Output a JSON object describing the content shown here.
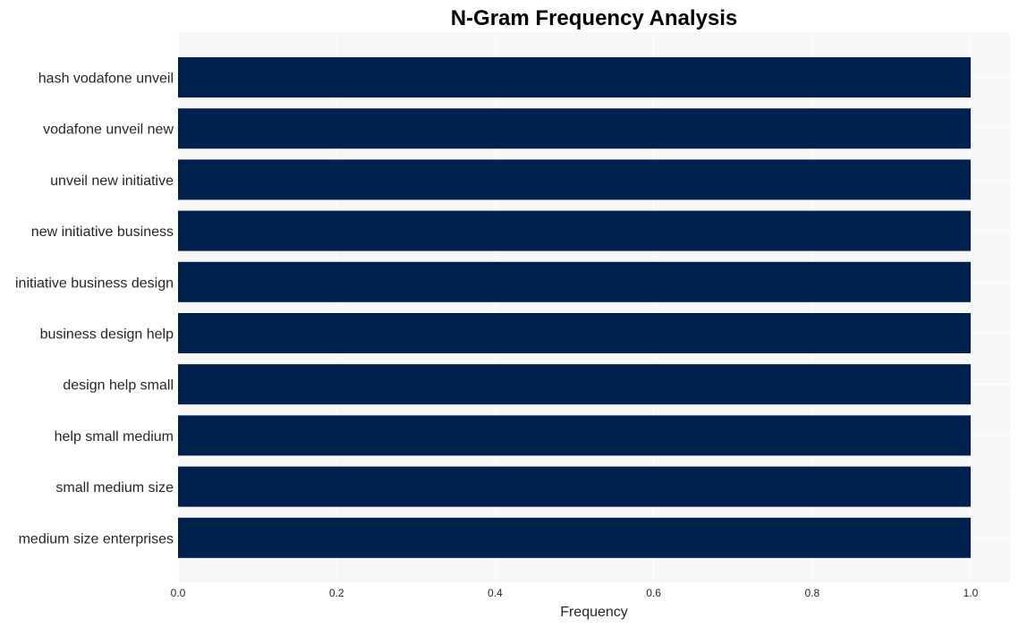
{
  "chart_data": {
    "type": "bar",
    "orientation": "horizontal",
    "title": "N-Gram Frequency Analysis",
    "xlabel": "Frequency",
    "ylabel": "",
    "categories": [
      "hash vodafone unveil",
      "vodafone unveil new",
      "unveil new initiative",
      "new initiative business",
      "initiative business design",
      "business design help",
      "design help small",
      "help small medium",
      "small medium size",
      "medium size enterprises"
    ],
    "values": [
      1,
      1,
      1,
      1,
      1,
      1,
      1,
      1,
      1,
      1
    ],
    "xlim": [
      0,
      1.05
    ],
    "xticks": [
      0.0,
      0.2,
      0.4,
      0.6,
      0.8,
      1.0
    ],
    "xtick_labels": [
      "0.0",
      "0.2",
      "0.4",
      "0.6",
      "0.8",
      "1.0"
    ],
    "grid": true,
    "legend": "none",
    "colors": {
      "bar": "#00214d",
      "plot_background": "#f7f7f7",
      "grid": "#ffffff"
    }
  }
}
